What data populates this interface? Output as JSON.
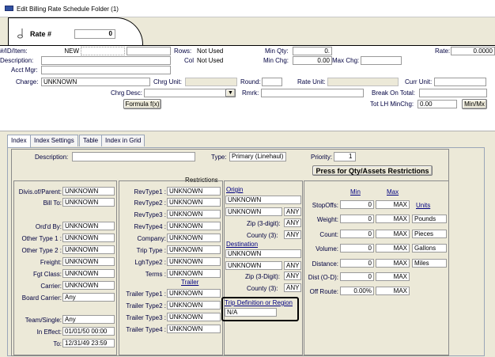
{
  "window": {
    "title": "Edit Billing Rate Schedule Folder (1)"
  },
  "header": {
    "rate_label": "Rate #",
    "rate_value": "0"
  },
  "top": {
    "id_item_label": "#/ID/Item:",
    "id_item_value": "NEW",
    "rows_label": "Rows:",
    "rows_value": "Not Used",
    "min_qty_label": "Min Qty:",
    "min_qty_value": "0.",
    "rate_label": "Rate:",
    "rate_value": "0.0000",
    "description_label": "Description:",
    "col_label": "Col",
    "col_value": "Not Used",
    "min_chg_label": "Min Chg:",
    "min_chg_value": "0.00",
    "max_chg_label": "Max Chg:",
    "acct_mgr_label": "Acct Mgr:",
    "charge_label": "Charge:",
    "charge_value": "UNKNOWN",
    "chrg_unit_label": "Chrg Unit:",
    "round_label": "Round:",
    "rate_unit_label": "Rate Unit:",
    "curr_unit_label": "Curr Unit:",
    "chrg_desc_label": "Chrg Desc:",
    "rmrk_label": "Rmrk:",
    "break_on_total_label": "Break On Total:",
    "formula_button": "Formula f(x)",
    "tot_lh_label": "Tot LH MinChg:",
    "tot_lh_value": "0.00",
    "min_mx_button": "Min/Mx"
  },
  "tabs": [
    "Index",
    "Index Settings",
    "Table",
    "Index in Grid"
  ],
  "index": {
    "description_label": "Description:",
    "type_label": "Type:",
    "type_value": "Primary (Linehaul)",
    "priority_label": "Priority:",
    "priority_value": "1",
    "press_button": "Press for Qty/Assets Restrictions",
    "restrictions_label": "Restrictions"
  },
  "left": [
    {
      "label": "Divis.of/Parent:",
      "value": "UNKNOWN"
    },
    {
      "label": "Bill To:",
      "value": "UNKNOWN"
    },
    {
      "label": "Ord'd By:",
      "value": "UNKNOWN"
    },
    {
      "label": "Other Type 1 :",
      "value": "UNKNOWN"
    },
    {
      "label": "Other Type 2 :",
      "value": "UNKNOWN"
    },
    {
      "label": "Freight:",
      "value": "UNKNOWN"
    },
    {
      "label": "Fgt Class:",
      "value": "UNKNOWN"
    },
    {
      "label": "Carrier:",
      "value": "UNKNOWN"
    },
    {
      "label": "Board Carrier:",
      "value": "Any"
    },
    {
      "label": "Team/Single:",
      "value": "Any"
    },
    {
      "label": "In Effect:",
      "value": "01/01/50 00:00"
    },
    {
      "label": "To:",
      "value": "12/31/49 23:59"
    }
  ],
  "mid": [
    {
      "label": "RevType1 :",
      "value": "UNKNOWN"
    },
    {
      "label": "RevType2 :",
      "value": "UNKNOWN"
    },
    {
      "label": "RevType3 :",
      "value": "UNKNOWN"
    },
    {
      "label": "RevType4 :",
      "value": "UNKNOWN"
    },
    {
      "label": "Company:",
      "value": "UNKNOWN"
    },
    {
      "label": "Trip Type :",
      "value": "UNKNOWN"
    },
    {
      "label": "LghType2 :",
      "value": "UNKNOWN"
    },
    {
      "label": "Terms :",
      "value": "UNKNOWN"
    },
    {
      "label": "Trailer Type1 :",
      "value": "UNKNOWN"
    },
    {
      "label": "Trailer Type2 :",
      "value": "UNKNOWN"
    },
    {
      "label": "Trailer Type3 :",
      "value": "UNKNOWN"
    },
    {
      "label": "Trailer Type4 :",
      "value": "UNKNOWN"
    }
  ],
  "trailer_label": "Trailer",
  "origin": {
    "label": "Origin",
    "value1": "UNKNOWN",
    "value2": "UNKNOWN",
    "any1": "ANY",
    "zip_label": "Zip (3-digit):",
    "zip_value": "ANY",
    "county_label": "County (3):",
    "county_value": "ANY"
  },
  "destination": {
    "label": "Destination",
    "value1": "UNKNOWN",
    "value2": "UNKNOWN",
    "any1": "ANY",
    "zip_label": "Zip (3-Digit):",
    "zip_value": "ANY",
    "county_label": "County (3):",
    "county_value": "ANY"
  },
  "trip_def": {
    "label": "Trip Definition or Region",
    "value": "N/A"
  },
  "right": {
    "min_label": "Min",
    "max_label": "Max",
    "units_label": "Units",
    "rows": [
      {
        "label": "StopOffs:",
        "min": "0",
        "max": "MAX",
        "unit": ""
      },
      {
        "label": "Weight:",
        "min": "0",
        "max": "MAX",
        "unit": "Pounds"
      },
      {
        "label": "Count:",
        "min": "0",
        "max": "MAX",
        "unit": "Pieces"
      },
      {
        "label": "Volume:",
        "min": "0",
        "max": "MAX",
        "unit": "Gallons"
      },
      {
        "label": "Distance:",
        "min": "0",
        "max": "MAX",
        "unit": "Miles"
      },
      {
        "label": "Dist (O-D):",
        "min": "0",
        "max": "MAX",
        "unit": ""
      },
      {
        "label": "Off Route:",
        "min": "0.00%",
        "max": "MAX",
        "unit": ""
      }
    ]
  }
}
